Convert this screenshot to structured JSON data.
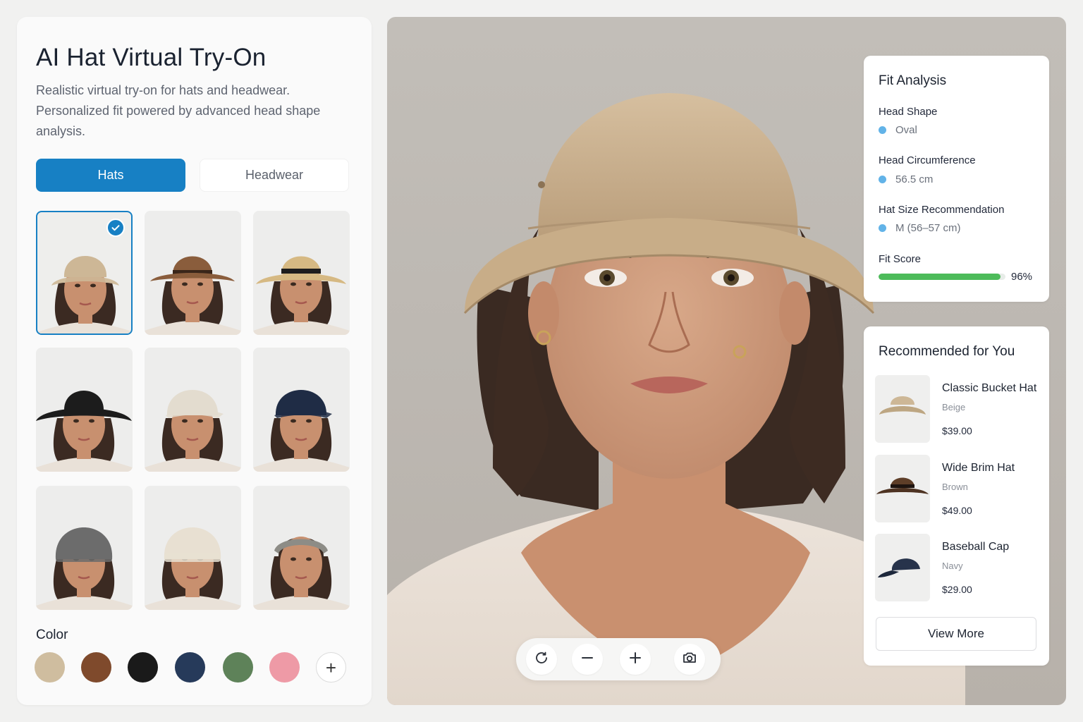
{
  "app": {
    "title": "AI Hat Virtual Try-On",
    "description": "Realistic virtual try-on for hats and headwear. Personalized fit powered by advanced head shape analysis."
  },
  "tabs": [
    {
      "label": "Hats",
      "active": true
    },
    {
      "label": "Headwear",
      "active": false
    }
  ],
  "hats": [
    {
      "style": "bucket",
      "color": "#cdb796",
      "selected": true
    },
    {
      "style": "fedora",
      "color": "#8a5d3c",
      "selected": false
    },
    {
      "style": "straw",
      "color": "#d6b983",
      "selected": false
    },
    {
      "style": "wide-brim",
      "color": "#1c1c1c",
      "selected": false
    },
    {
      "style": "cap",
      "color": "#e3dccf",
      "selected": false
    },
    {
      "style": "cap",
      "color": "#1f2c45",
      "selected": false
    },
    {
      "style": "beanie",
      "color": "#6c6c6c",
      "selected": false
    },
    {
      "style": "beanie",
      "color": "#e8e0d2",
      "selected": false
    },
    {
      "style": "headband",
      "color": "#8d8c86",
      "selected": false
    }
  ],
  "colors": {
    "label": "Color",
    "swatches": [
      "#cfbd9f",
      "#7f4a2c",
      "#1a1a1a",
      "#263a5a",
      "#5e8259",
      "#ee9aa6"
    ],
    "add_symbol": "+"
  },
  "toolbar": {
    "icons": [
      "rotate-icon",
      "zoom-out-icon",
      "zoom-in-icon",
      "camera-icon"
    ]
  },
  "fit_analysis": {
    "title": "Fit Analysis",
    "head_shape_label": "Head Shape",
    "head_shape_value": "Oval",
    "circumference_label": "Head Circumference",
    "circumference_value": "56.5 cm",
    "size_label": "Hat Size Recommendation",
    "size_value": "M (56–57 cm)",
    "score_label": "Fit Score",
    "score_text": "96%",
    "score_fraction": 0.96,
    "accent": "#62b3e8",
    "score_color": "#4dbb5a"
  },
  "recommended": {
    "title": "Recommended for You",
    "items": [
      {
        "name": "Classic Bucket Hat",
        "color": "Beige",
        "price": "$39.00"
      },
      {
        "name": "Wide Brim Hat",
        "color": "Brown",
        "price": "$49.00"
      },
      {
        "name": "Baseball Cap",
        "color": "Navy",
        "price": "$29.00"
      }
    ],
    "view_more": "View More"
  }
}
